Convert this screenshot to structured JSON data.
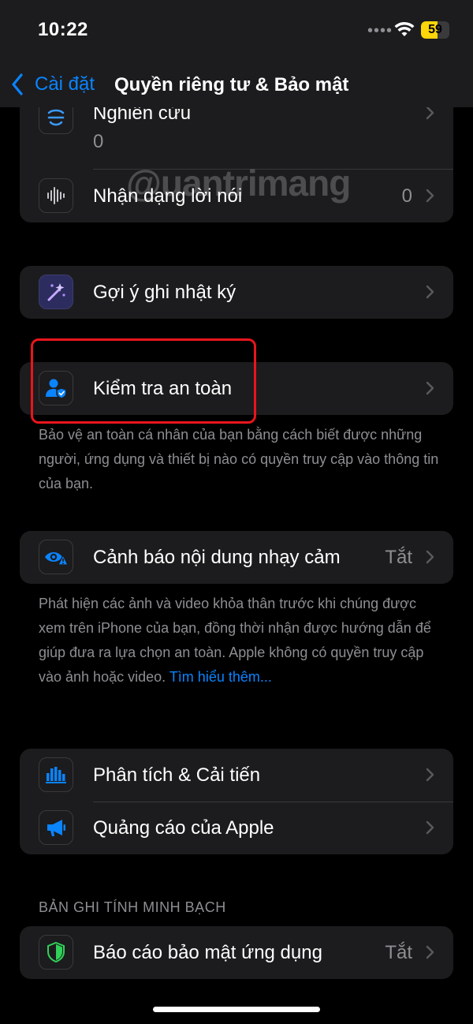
{
  "status_bar": {
    "time": "10:22",
    "battery_level": "59",
    "battery_fraction": 0.59
  },
  "nav": {
    "back_label": "Cài đặt",
    "title": "Quyền riêng tư & Bảo mật"
  },
  "group1": {
    "rows": [
      {
        "label": "Nghiên cứu",
        "value": "0",
        "icon": "research-icon"
      },
      {
        "label": "Nhận dạng lời nói",
        "value": "0",
        "icon": "waveform-icon"
      }
    ]
  },
  "group2": {
    "rows": [
      {
        "label": "Gợi ý ghi nhật ký",
        "icon": "sparkle-wand-icon"
      }
    ]
  },
  "group3": {
    "rows": [
      {
        "label": "Kiểm tra an toàn",
        "icon": "person-shield-icon"
      }
    ],
    "footer": "Bảo vệ an toàn cá nhân của bạn bằng cách biết được những người, ứng dụng và thiết bị nào có quyền truy cập vào thông tin của bạn."
  },
  "group4": {
    "rows": [
      {
        "label": "Cảnh báo nội dung nhạy cảm",
        "value": "Tắt",
        "icon": "eye-warning-icon"
      }
    ],
    "footer": "Phát hiện các ảnh và video khỏa thân trước khi chúng được xem trên iPhone của bạn, đồng thời nhận được hướng dẫn để giúp đưa ra lựa chọn an toàn. Apple không có quyền truy cập vào ảnh hoặc video.",
    "footer_link": "Tìm hiểu thêm..."
  },
  "group5": {
    "rows": [
      {
        "label": "Phân tích & Cải tiến",
        "icon": "bar-chart-icon"
      },
      {
        "label": "Quảng cáo của Apple",
        "icon": "megaphone-icon"
      }
    ]
  },
  "section_transparency": {
    "header": "BẢN GHI TÍNH MINH BẠCH",
    "rows": [
      {
        "label": "Báo cáo bảo mật ứng dụng",
        "value": "Tắt",
        "icon": "green-shield-icon"
      }
    ]
  },
  "watermark": "@uantrimang",
  "colors": {
    "accent": "#0a84ff",
    "highlight": "#e8151b",
    "background": "#000000",
    "cell": "#1c1c1e"
  }
}
